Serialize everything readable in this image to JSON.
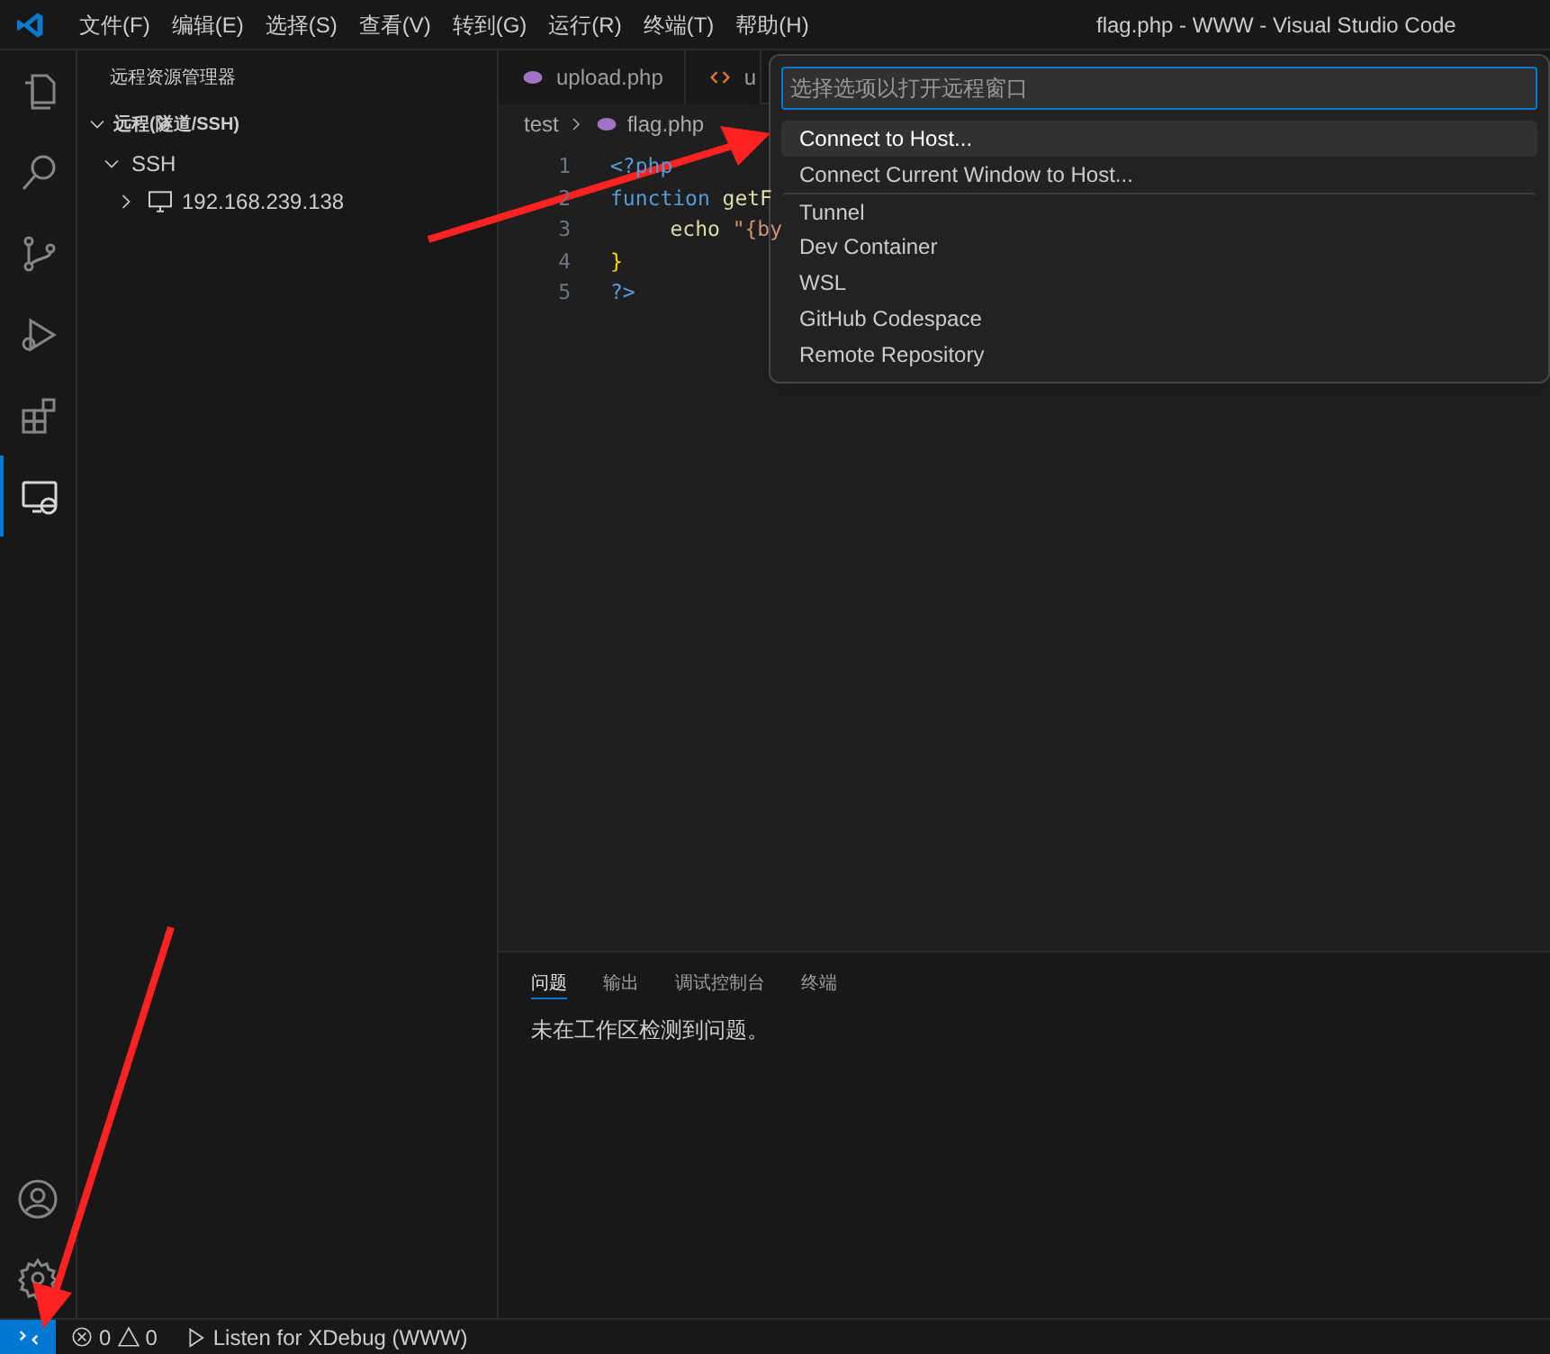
{
  "title_bar": {
    "menus": [
      "文件(F)",
      "编辑(E)",
      "选择(S)",
      "查看(V)",
      "转到(G)",
      "运行(R)",
      "终端(T)",
      "帮助(H)"
    ],
    "title": "flag.php - WWW - Visual Studio Code"
  },
  "activity_bar": [
    {
      "kind": "files",
      "selected": false
    },
    {
      "kind": "search",
      "selected": false
    },
    {
      "kind": "scm",
      "selected": false
    },
    {
      "kind": "debug",
      "selected": false
    },
    {
      "kind": "extensions",
      "selected": false
    },
    {
      "kind": "remote",
      "selected": true
    }
  ],
  "sidebar": {
    "title": "远程资源管理器",
    "section": "远程(隧道/SSH)",
    "tree": [
      {
        "label": "SSH",
        "expanded": true,
        "children": [
          {
            "label": "192.168.239.138",
            "expanded": false
          }
        ]
      }
    ]
  },
  "tabs": [
    {
      "label": "upload.php",
      "kind": "php",
      "selected": false
    },
    {
      "label": "u",
      "kind": "html",
      "selected": false
    }
  ],
  "breadcrumb": [
    "test",
    "flag.php"
  ],
  "code": [
    {
      "number": "1",
      "indented": false,
      "tokens": [
        {
          "kind": "tag",
          "text": "<?php"
        }
      ]
    },
    {
      "number": "2",
      "indented": false,
      "tokens": [
        {
          "kind": "keyword",
          "text": "function"
        },
        {
          "kind": "func",
          "text": "getF"
        }
      ]
    },
    {
      "number": "3",
      "indented": true,
      "tokens": [
        {
          "kind": "func",
          "text": "echo"
        },
        {
          "kind": "string",
          "text": "\"{by"
        }
      ]
    },
    {
      "number": "4",
      "indented": false,
      "tokens": [
        {
          "kind": "brace",
          "text": "}"
        }
      ]
    },
    {
      "number": "5",
      "indented": false,
      "tokens": [
        {
          "kind": "tag",
          "text": "?>"
        }
      ]
    }
  ],
  "quick_pick": {
    "placeholder": "选择选项以打开远程窗口",
    "items": [
      {
        "label": "Connect to Host...",
        "selected": true
      },
      {
        "label": "Connect Current Window to Host...",
        "selected": false
      },
      {
        "label": "Tunnel",
        "selected": false
      },
      {
        "label": "Dev Container",
        "selected": false
      },
      {
        "label": "WSL",
        "selected": false
      },
      {
        "label": "GitHub Codespace",
        "selected": false
      },
      {
        "label": "Remote Repository",
        "selected": false
      }
    ]
  },
  "panel": {
    "tabs": [
      {
        "label": "问题",
        "selected": true
      },
      {
        "label": "输出",
        "selected": false
      },
      {
        "label": "调试控制台",
        "selected": false
      },
      {
        "label": "终端",
        "selected": false
      }
    ],
    "message": "未在工作区检测到问题。"
  },
  "status_bar": {
    "errors": "0",
    "warnings": "0",
    "debug": "Listen for XDebug (WWW)"
  }
}
